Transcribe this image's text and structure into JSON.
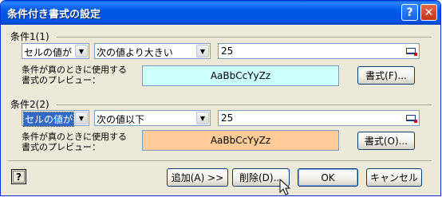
{
  "window": {
    "title": "条件付き書式の設定",
    "help_glyph": "?",
    "close_glyph": "✕"
  },
  "condition1": {
    "label": "条件1(1)",
    "type_value": "セルの値が",
    "operator_value": "次の値より大きい",
    "value": "25",
    "preview_label": "条件が真のときに使用する書式のプレビュー：",
    "preview_text": "AaBbCcYyZz",
    "preview_bg": "#ccffff",
    "format_button": "書式(F)..."
  },
  "condition2": {
    "label": "条件2(2)",
    "type_value": "セルの値が",
    "operator_value": "次の値以下",
    "value": "25",
    "preview_label": "条件が真のときに使用する書式のプレビュー：",
    "preview_text": "AaBbCcYyZz",
    "preview_bg": "#ffcc99",
    "format_button": "書式(O)..."
  },
  "footer": {
    "help_glyph": "?",
    "add_button": "追加(A) >>",
    "delete_button": "削除(D)...",
    "ok_button": "OK",
    "cancel_button": "キャンセル"
  },
  "icons": {
    "dropdown": "chevron-down-icon",
    "collapse": "collapse-dialog-icon",
    "cursor": "mouse-pointer-icon"
  }
}
